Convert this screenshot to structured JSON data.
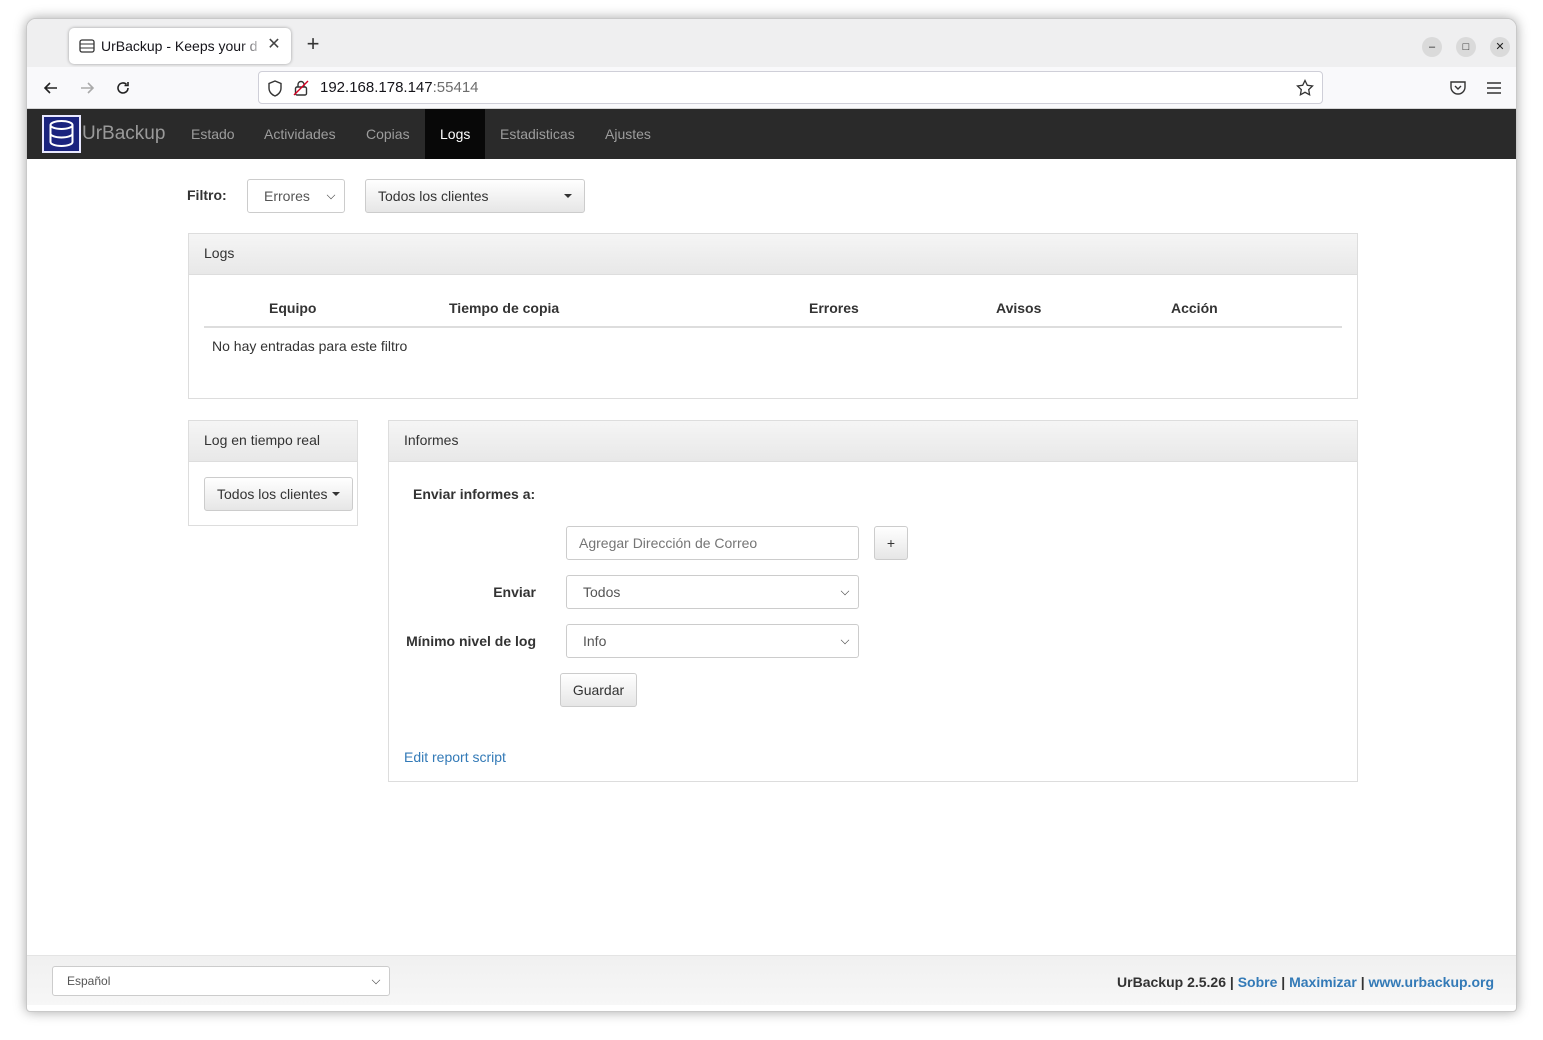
{
  "browser": {
    "tab_title": "UrBackup - Keeps your d",
    "tab_close": "✕",
    "new_tab": "+",
    "url_host": "192.168.178.147",
    "url_port": ":55414",
    "controls": {
      "minimize": "–",
      "maximize": "□",
      "close": "✕"
    }
  },
  "app": {
    "brand": "UrBackup",
    "nav": [
      "Estado",
      "Actividades",
      "Copias",
      "Logs",
      "Estadisticas",
      "Ajustes"
    ],
    "active_nav": "Logs"
  },
  "filter": {
    "label": "Filtro:",
    "level_value": "Errores",
    "clients_value": "Todos los clientes"
  },
  "logs_panel": {
    "title": "Logs",
    "columns": [
      "Equipo",
      "Tiempo de copia",
      "Errores",
      "Avisos",
      "Acción"
    ],
    "empty_message": "No hay entradas para este filtro"
  },
  "realtime_panel": {
    "title": "Log en tiempo real",
    "clients_button": "Todos los clientes"
  },
  "reports_panel": {
    "title": "Informes",
    "send_reports_label": "Enviar informes a:",
    "email_placeholder": "Agregar Dirección de Correo",
    "add_button": "+",
    "send_label": "Enviar",
    "send_value": "Todos",
    "min_level_label": "Mínimo nivel de log",
    "min_level_value": "Info",
    "save_button": "Guardar",
    "edit_script_link": "Edit report script"
  },
  "footer": {
    "language": "Español",
    "version": "UrBackup 2.5.26",
    "sep": "|",
    "about": "Sobre",
    "maximize": "Maximizar",
    "website": "www.urbackup.org"
  }
}
